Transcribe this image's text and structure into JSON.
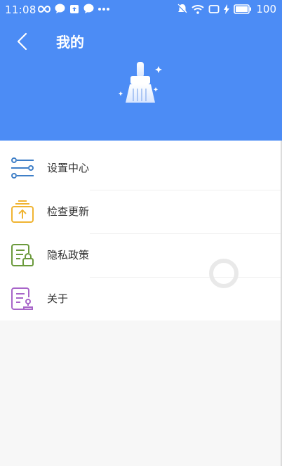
{
  "status_bar": {
    "time": "11:08",
    "battery": "100"
  },
  "header": {
    "title": "我的",
    "background_color": "#4c8cf5"
  },
  "menu": {
    "items": [
      {
        "label": "设置中心",
        "icon": "settings-sliders-icon",
        "color": "#3f7fc7"
      },
      {
        "label": "检查更新",
        "icon": "upload-box-icon",
        "color": "#f0b432"
      },
      {
        "label": "隐私政策",
        "icon": "privacy-lock-icon",
        "color": "#6b9a3c"
      },
      {
        "label": "关于",
        "icon": "about-document-icon",
        "color": "#a865c9"
      }
    ]
  }
}
